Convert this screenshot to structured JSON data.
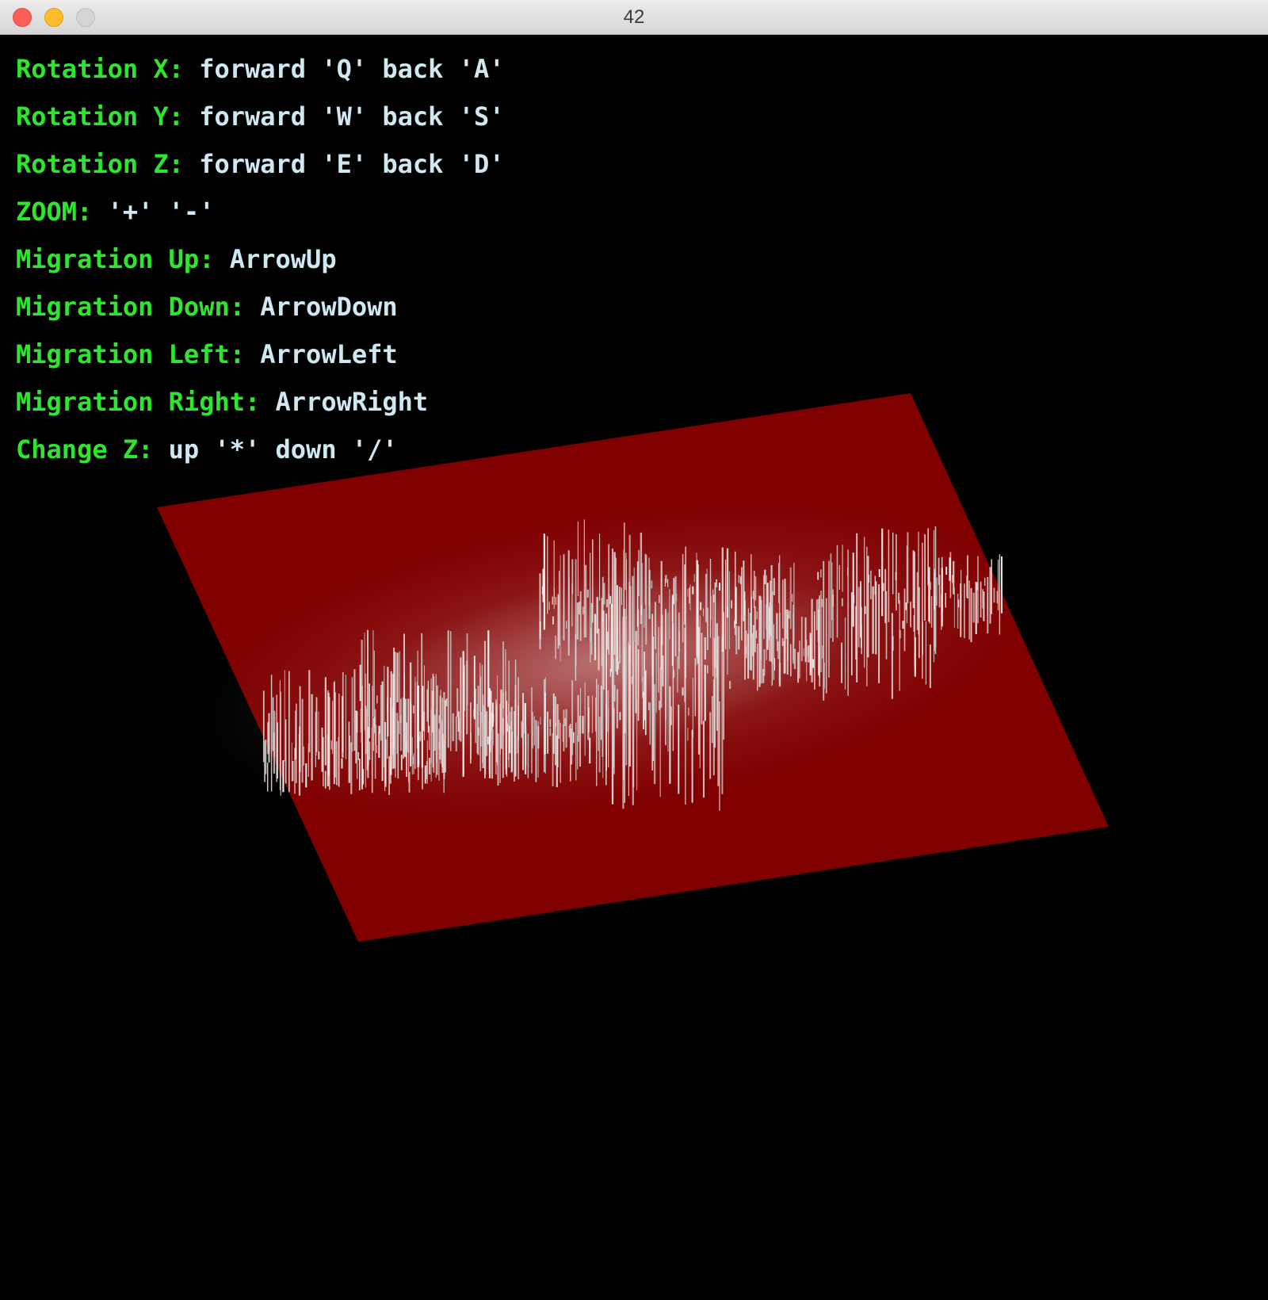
{
  "window": {
    "title": "42",
    "controls": {
      "close": "close-button",
      "minimize": "minimize-button",
      "maximize": "maximize-button"
    }
  },
  "help": {
    "lines": [
      {
        "label": "Rotation X:",
        "value": "forward 'Q' back 'A'"
      },
      {
        "label": "Rotation Y:",
        "value": "forward 'W' back 'S'"
      },
      {
        "label": "Rotation Z:",
        "value": "forward 'E' back 'D'"
      },
      {
        "label": "ZOOM:",
        "value": "'+' '-'"
      },
      {
        "label": "Migration Up:",
        "value": "ArrowUp"
      },
      {
        "label": "Migration Down:",
        "value": "ArrowDown"
      },
      {
        "label": "Migration Left:",
        "value": "ArrowLeft"
      },
      {
        "label": "Migration Right:",
        "value": "ArrowRight"
      },
      {
        "label": "Change Z:",
        "value": "up '*' down '/'"
      }
    ]
  },
  "colors": {
    "background": "#000000",
    "label": "#2ee62e",
    "value": "#cfe8f2",
    "plane": "#800000",
    "peaks": "#ffffff"
  }
}
